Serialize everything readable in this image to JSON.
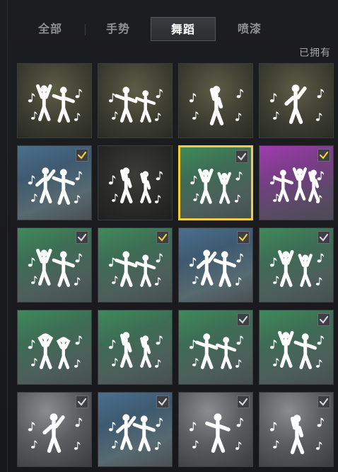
{
  "tabs": [
    {
      "label": "全部",
      "active": false
    },
    {
      "label": "手势",
      "active": false
    },
    {
      "label": "舞蹈",
      "active": true
    },
    {
      "label": "喷漆",
      "active": false
    }
  ],
  "owned_label": "已拥有",
  "colors": {
    "accent_yellow": "#f2cf3a",
    "check_gray": "#d4d6da",
    "bg": "#16171a"
  },
  "emotes": [
    {
      "bg": "olive",
      "check": "none",
      "selected": false,
      "pose": "duo-raise"
    },
    {
      "bg": "olive",
      "check": "none",
      "selected": false,
      "pose": "duo-squat"
    },
    {
      "bg": "olive",
      "check": "none",
      "selected": false,
      "pose": "solo-flute"
    },
    {
      "bg": "olive",
      "check": "none",
      "selected": false,
      "pose": "solo-point"
    },
    {
      "bg": "blue",
      "check": "yellow",
      "selected": false,
      "pose": "duo-lean"
    },
    {
      "bg": "dark",
      "check": "none",
      "selected": false,
      "pose": "duo-mic"
    },
    {
      "bg": "green",
      "check": "gray",
      "selected": true,
      "pose": "duo-arms-up"
    },
    {
      "bg": "purple",
      "check": "yellow",
      "selected": false,
      "pose": "band"
    },
    {
      "bg": "green",
      "check": "gray",
      "selected": false,
      "pose": "duo-raise"
    },
    {
      "bg": "green",
      "check": "yellow",
      "selected": false,
      "pose": "duo-squat"
    },
    {
      "bg": "blue",
      "check": "yellow",
      "selected": false,
      "pose": "duo-lean"
    },
    {
      "bg": "green",
      "check": "gray",
      "selected": false,
      "pose": "duo-arms-up"
    },
    {
      "bg": "green",
      "check": "none",
      "selected": false,
      "pose": "duo-hands-head"
    },
    {
      "bg": "green",
      "check": "none",
      "selected": false,
      "pose": "duo-mic"
    },
    {
      "bg": "green",
      "check": "gray",
      "selected": false,
      "pose": "duo-squat"
    },
    {
      "bg": "green",
      "check": "gray",
      "selected": false,
      "pose": "duo-raise"
    },
    {
      "bg": "gray",
      "check": "gray",
      "selected": false,
      "pose": "solo-point"
    },
    {
      "bg": "blue",
      "check": "gray",
      "selected": false,
      "pose": "duo-lean"
    },
    {
      "bg": "gray",
      "check": "gray",
      "selected": false,
      "pose": "solo-kick"
    },
    {
      "bg": "gray",
      "check": "gray",
      "selected": false,
      "pose": "solo-flute"
    }
  ]
}
